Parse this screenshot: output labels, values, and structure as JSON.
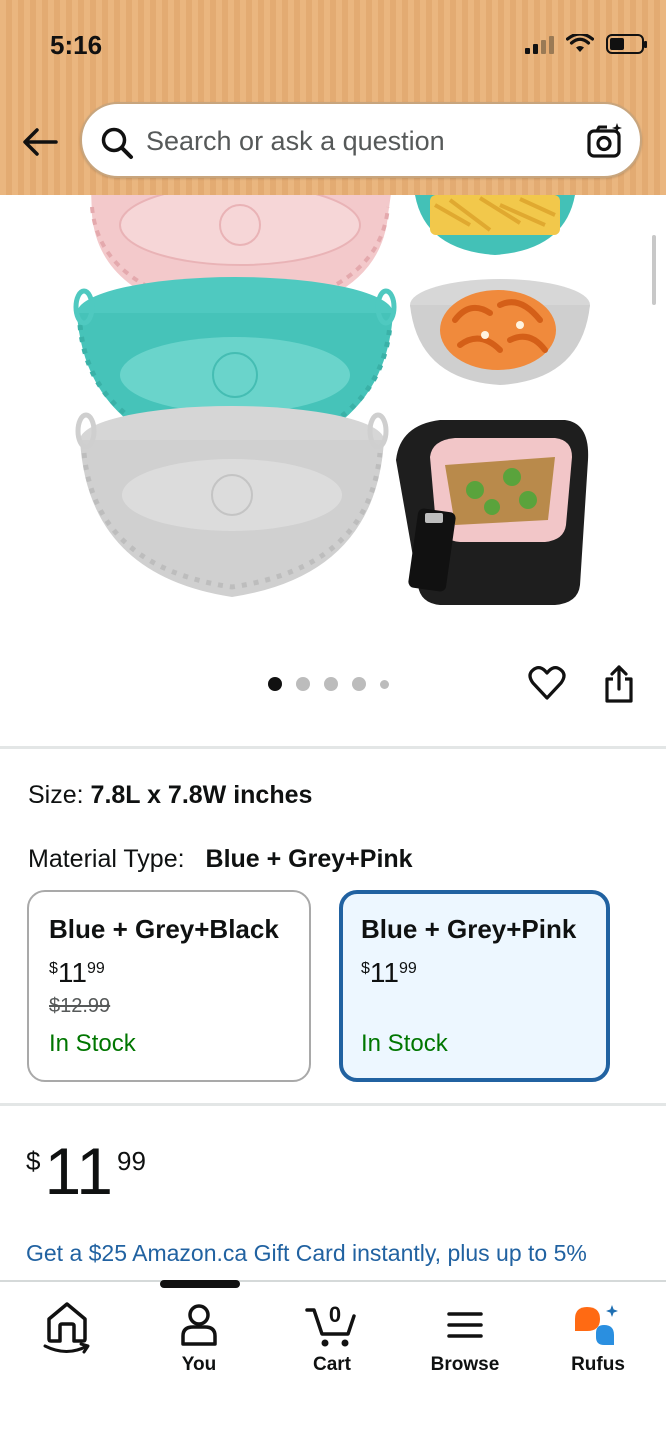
{
  "status_bar": {
    "time": "5:16"
  },
  "search": {
    "placeholder": "Search or ask a question"
  },
  "product": {
    "image_alt": "Silicone air fryer liners in pink, blue and grey",
    "carousel": {
      "total": 5,
      "active": 1
    },
    "size_label": "Size:",
    "size_value": "7.8L x 7.8W inches",
    "material_label": "Material Type:",
    "material_value": "Blue + Grey+Pink",
    "variants": [
      {
        "name": "Blue + Grey+Black",
        "price_symbol": "$",
        "price_whole": "11",
        "price_cents": "99",
        "list_price": "$12.99",
        "stock": "In Stock",
        "selected": false
      },
      {
        "name": "Blue + Grey+Pink",
        "price_symbol": "$",
        "price_whole": "11",
        "price_cents": "99",
        "list_price": "",
        "stock": "In Stock",
        "selected": true
      }
    ],
    "price": {
      "symbol": "$",
      "whole": "11",
      "cents": "99"
    },
    "promo": "Get a $25 Amazon.ca Gift Card instantly, plus up to 5%"
  },
  "nav": {
    "items": [
      {
        "label": "",
        "icon": "home-icon"
      },
      {
        "label": "You",
        "icon": "person-icon"
      },
      {
        "label": "Cart",
        "icon": "cart-icon",
        "badge": "0"
      },
      {
        "label": "Browse",
        "icon": "menu-icon"
      },
      {
        "label": "Rufus",
        "icon": "rufus-icon"
      }
    ]
  },
  "colors": {
    "header_bg": "#eab67f",
    "link": "#2162a1",
    "in_stock": "#007600",
    "selected_border": "#2162a1",
    "selected_bg": "#edf7ff",
    "rufus_orange": "#ff6a13",
    "rufus_blue": "#2a8fe0"
  }
}
